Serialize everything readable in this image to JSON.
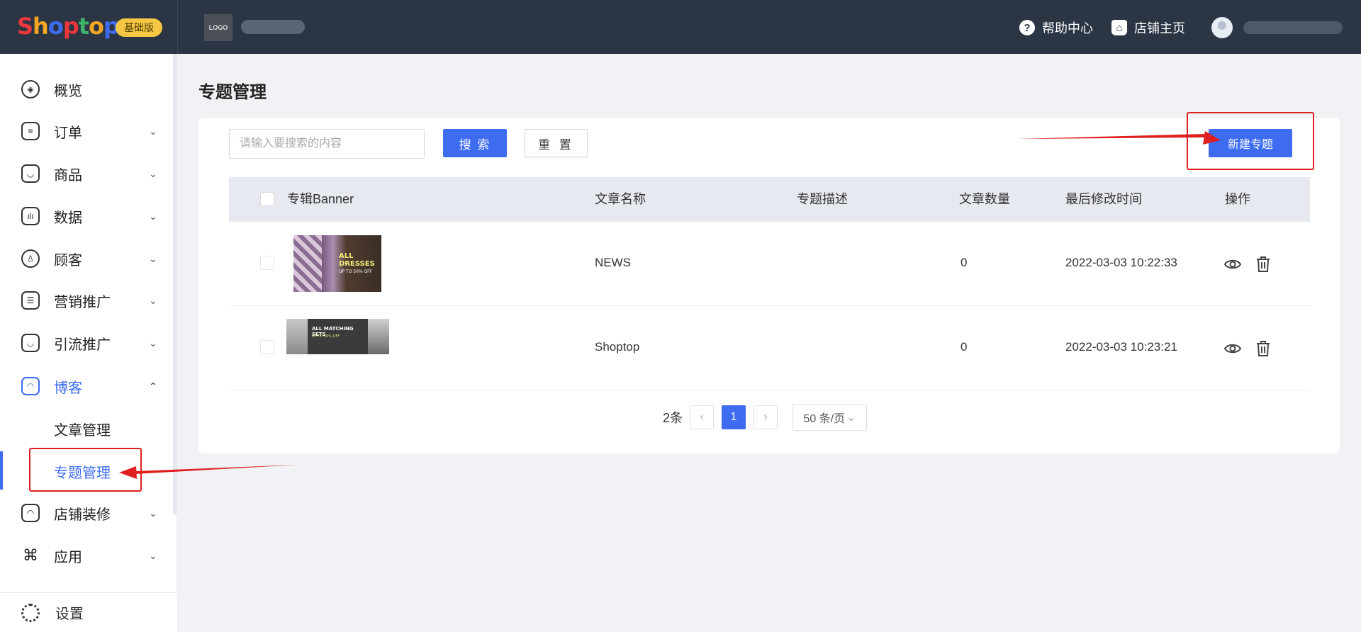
{
  "header": {
    "brand": "Shoptop",
    "brand_letters": [
      {
        "ch": "S",
        "color": "#e8383d"
      },
      {
        "ch": "h",
        "color": "#f5a623"
      },
      {
        "ch": "o",
        "color": "#3d6cf0"
      },
      {
        "ch": "p",
        "color": "#e8383d"
      },
      {
        "ch": "t",
        "color": "#3db36b"
      },
      {
        "ch": "o",
        "color": "#f5a623"
      },
      {
        "ch": "p",
        "color": "#3d6cf0"
      }
    ],
    "edition": "基础版",
    "store_logo": "LOGO",
    "help": "帮助中心",
    "store_home": "店铺主页"
  },
  "sidebar": {
    "items": [
      {
        "label": "概览",
        "icon": "compass-icon"
      },
      {
        "label": "订单",
        "icon": "order-icon"
      },
      {
        "label": "商品",
        "icon": "product-icon"
      },
      {
        "label": "数据",
        "icon": "chart-icon"
      },
      {
        "label": "顾客",
        "icon": "user-icon"
      },
      {
        "label": "营销推广",
        "icon": "ticket-icon"
      },
      {
        "label": "引流推广",
        "icon": "bag-icon"
      },
      {
        "label": "博客",
        "icon": "blog-icon"
      },
      {
        "label": "店铺装修",
        "icon": "store-icon"
      },
      {
        "label": "应用",
        "icon": "apps-icon"
      }
    ],
    "blog_sub": [
      "文章管理",
      "专题管理"
    ],
    "settings": "设置"
  },
  "page": {
    "title": "专题管理",
    "search_placeholder": "请输入要搜索的内容",
    "search_button": "搜 索",
    "reset_button": "重 置",
    "new_button": "新建专题"
  },
  "table": {
    "headers": [
      "专辑Banner",
      "文章名称",
      "专题描述",
      "文章数量",
      "最后修改时间",
      "操作"
    ],
    "rows": [
      {
        "banner_text": "ALL DRESSES",
        "banner_sub": "UP TO 50% OFF",
        "title": "NEWS",
        "desc": "",
        "count": "0",
        "modified": "2022-03-03 10:22:33"
      },
      {
        "banner_text": "ALL MATCHING SETS",
        "banner_sub": "UP TO 50% OFF",
        "title": "Shoptop",
        "desc": "",
        "count": "0",
        "modified": "2022-03-03 10:23:21"
      }
    ]
  },
  "pagination": {
    "total": "2条",
    "current": "1",
    "page_size": "50 条/页"
  },
  "colors": {
    "accent": "#3d6cf0",
    "topbar": "#2b3544",
    "annotation": "#e02020"
  }
}
